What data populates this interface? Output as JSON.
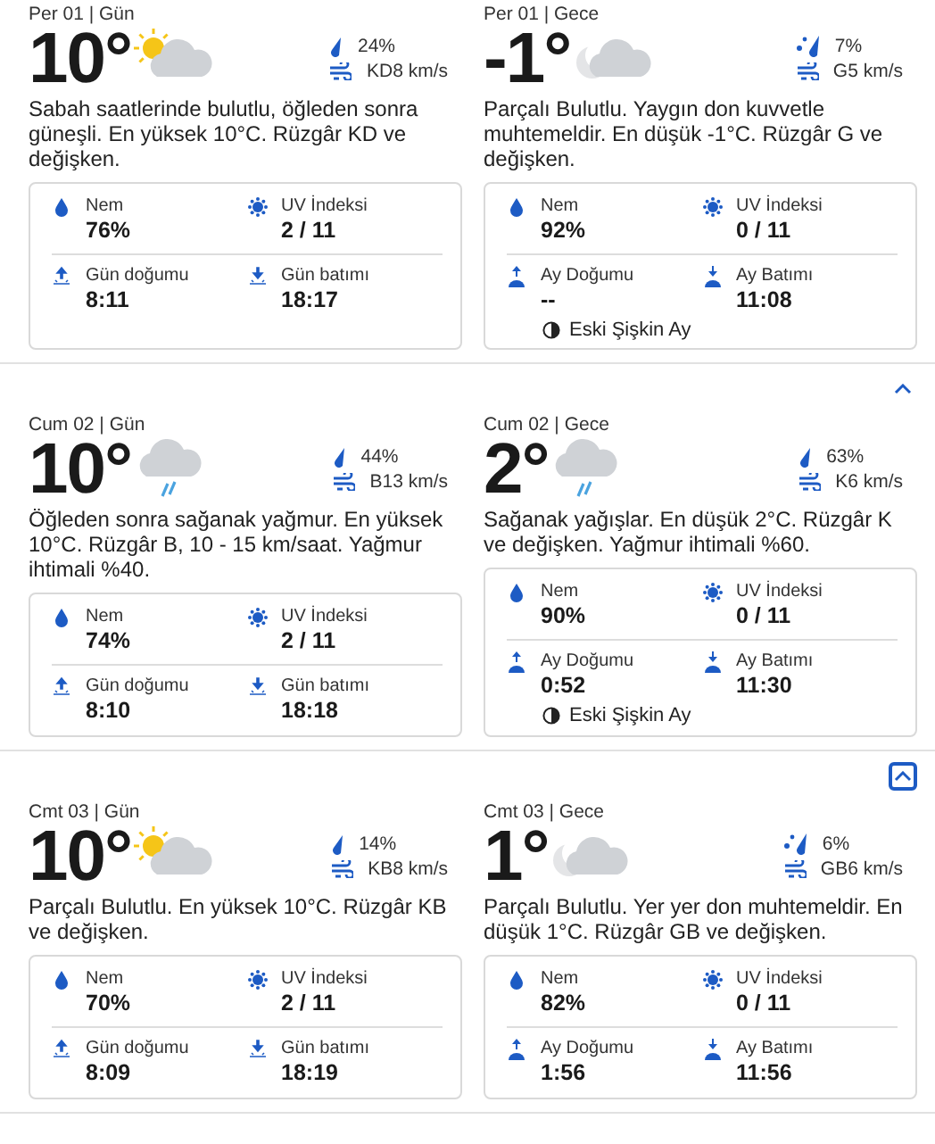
{
  "sections": [
    {
      "cards": [
        {
          "period": "Per 01 | Gün",
          "temp": "10°",
          "kind": "sunny",
          "precip": {
            "kind": "rain",
            "text": "24%"
          },
          "wind": "KD8 km/s",
          "description": "Sabah saatlerinde bulutlu, öğleden sonra güneşli. En yüksek 10°C. Rüzgâr KD ve değişken.",
          "details": [
            {
              "kind": "humidity",
              "label": "Nem",
              "value": "76%"
            },
            {
              "kind": "uv",
              "label": "UV İndeksi",
              "value": "2 / 11"
            },
            {
              "kind": "sunrise",
              "label": "Gün doğumu",
              "value": "8:11"
            },
            {
              "kind": "sunset",
              "label": "Gün batımı",
              "value": "18:17"
            }
          ]
        },
        {
          "period": "Per 01 | Gece",
          "temp": "-1°",
          "kind": "night",
          "precip": {
            "kind": "mix",
            "text": "7%"
          },
          "wind": "G5 km/s",
          "description": "Parçalı Bulutlu. Yaygın don kuvvetle muhtemeldir. En düşük -1°C. Rüzgâr G ve değişken.",
          "details": [
            {
              "kind": "humidity",
              "label": "Nem",
              "value": "92%"
            },
            {
              "kind": "uv",
              "label": "UV İndeksi",
              "value": "0 / 11"
            },
            {
              "kind": "moonrise",
              "label": "Ay Doğumu",
              "value": "--"
            },
            {
              "kind": "moonset",
              "label": "Ay Batımı",
              "value": "11:08"
            }
          ],
          "moon_phase": "Eski Şişkin Ay"
        }
      ]
    },
    {
      "collapse_button": {
        "focused": false
      },
      "cards": [
        {
          "period": "Cum 02 | Gün",
          "temp": "10°",
          "kind": "rainy",
          "precip": {
            "kind": "rain",
            "text": "44%"
          },
          "wind": "B13 km/s",
          "description": "Öğleden sonra sağanak yağmur. En yüksek 10°C. Rüzgâr B, 10 - 15 km/saat. Yağmur ihtimali %40.",
          "details": [
            {
              "kind": "humidity",
              "label": "Nem",
              "value": "74%"
            },
            {
              "kind": "uv",
              "label": "UV İndeksi",
              "value": "2 / 11"
            },
            {
              "kind": "sunrise",
              "label": "Gün doğumu",
              "value": "8:10"
            },
            {
              "kind": "sunset",
              "label": "Gün batımı",
              "value": "18:18"
            }
          ]
        },
        {
          "period": "Cum 02 | Gece",
          "temp": "2°",
          "kind": "rainy",
          "precip": {
            "kind": "rain",
            "text": "63%"
          },
          "wind": "K6 km/s",
          "description": "Sağanak yağışlar. En düşük 2°C. Rüzgâr K ve değişken. Yağmur ihtimali %60.",
          "details": [
            {
              "kind": "humidity",
              "label": "Nem",
              "value": "90%"
            },
            {
              "kind": "uv",
              "label": "UV İndeksi",
              "value": "0 / 11"
            },
            {
              "kind": "moonrise",
              "label": "Ay Doğumu",
              "value": "0:52"
            },
            {
              "kind": "moonset",
              "label": "Ay Batımı",
              "value": "11:30"
            }
          ],
          "moon_phase": "Eski Şişkin Ay"
        }
      ]
    },
    {
      "collapse_button": {
        "focused": true
      },
      "cards": [
        {
          "period": "Cmt 03 | Gün",
          "temp": "10°",
          "kind": "sunny",
          "precip": {
            "kind": "rain",
            "text": "14%"
          },
          "wind": "KB8 km/s",
          "description": "Parçalı Bulutlu. En yüksek 10°C. Rüzgâr KB ve değişken.",
          "details": [
            {
              "kind": "humidity",
              "label": "Nem",
              "value": "70%"
            },
            {
              "kind": "uv",
              "label": "UV İndeksi",
              "value": "2 / 11"
            },
            {
              "kind": "sunrise",
              "label": "Gün doğumu",
              "value": "8:09"
            },
            {
              "kind": "sunset",
              "label": "Gün batımı",
              "value": "18:19"
            }
          ]
        },
        {
          "period": "Cmt 03 | Gece",
          "temp": "1°",
          "kind": "night",
          "precip": {
            "kind": "mix",
            "text": "6%"
          },
          "wind": "GB6 km/s",
          "description": "Parçalı Bulutlu. Yer yer don muhtemeldir. En düşük 1°C. Rüzgâr GB ve değişken.",
          "details": [
            {
              "kind": "humidity",
              "label": "Nem",
              "value": "82%"
            },
            {
              "kind": "uv",
              "label": "UV İndeksi",
              "value": "0 / 11"
            },
            {
              "kind": "moonrise",
              "label": "Ay Doğumu",
              "value": "1:56"
            },
            {
              "kind": "moonset",
              "label": "Ay Batımı",
              "value": "11:56"
            }
          ]
        }
      ]
    }
  ]
}
